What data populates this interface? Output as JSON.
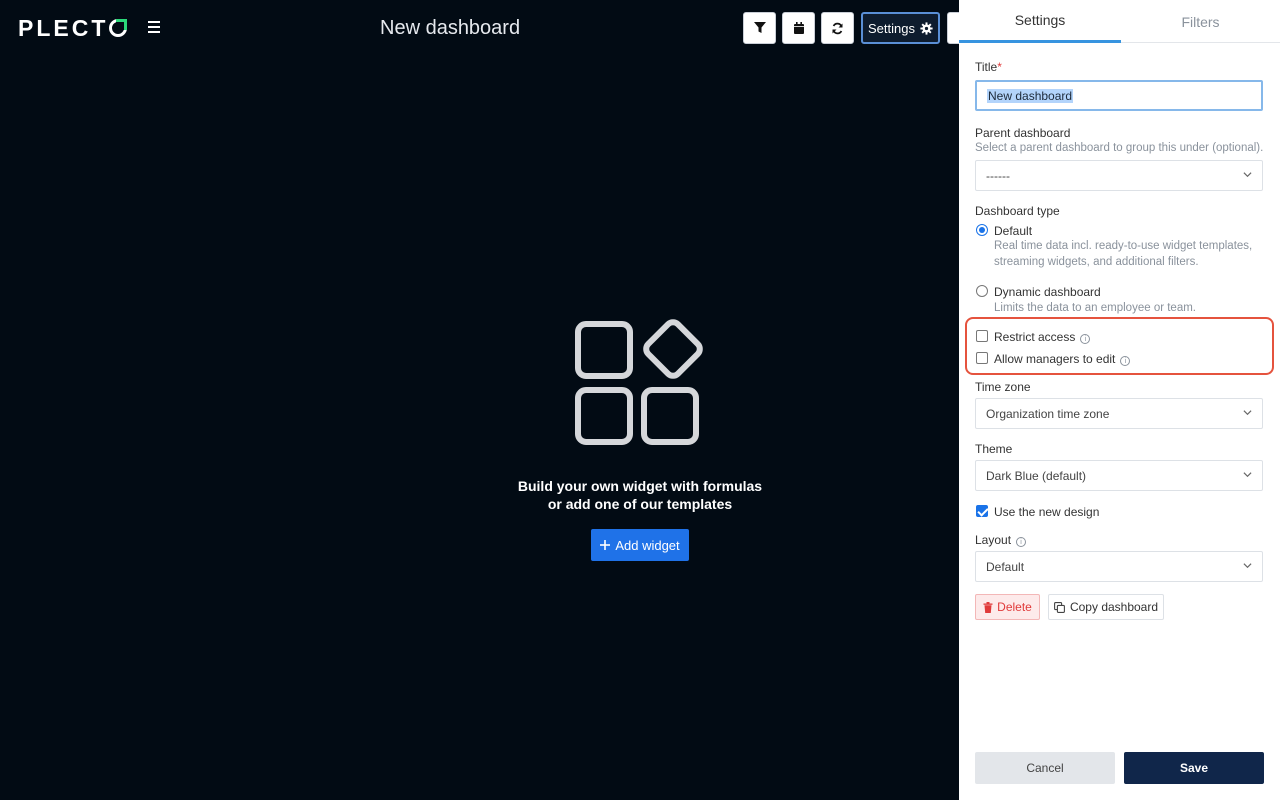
{
  "header": {
    "logo": "PLECT",
    "title": "New dashboard",
    "settings_label": "Settings"
  },
  "empty_state": {
    "line1": "Build your own widget with formulas",
    "line2": "or add one of our templates",
    "add_widget_label": "Add widget"
  },
  "panel": {
    "tabs": [
      "Settings",
      "Filters"
    ],
    "title_label": "Title",
    "title_required": "*",
    "title_value": "New dashboard",
    "parent_label": "Parent dashboard",
    "parent_help": "Select a parent dashboard to group this under (optional).",
    "parent_value": "------",
    "type_label": "Dashboard type",
    "type_default_title": "Default",
    "type_default_desc": "Real time data incl. ready-to-use widget templates, streaming widgets, and additional filters.",
    "type_dynamic_title": "Dynamic dashboard",
    "type_dynamic_desc": "Limits the data to an employee or team.",
    "restrict_access": "Restrict access",
    "allow_managers": "Allow managers to edit",
    "timezone_label": "Time zone",
    "timezone_value": "Organization time zone",
    "theme_label": "Theme",
    "theme_value": "Dark Blue (default)",
    "use_new_design": "Use the new design",
    "layout_label": "Layout",
    "layout_value": "Default",
    "delete_label": "Delete",
    "copy_label": "Copy dashboard",
    "cancel_label": "Cancel",
    "save_label": "Save"
  },
  "colors": {
    "background": "#020b14",
    "accent": "#1f72e8",
    "save": "#10264a",
    "highlight": "#e5533e"
  }
}
